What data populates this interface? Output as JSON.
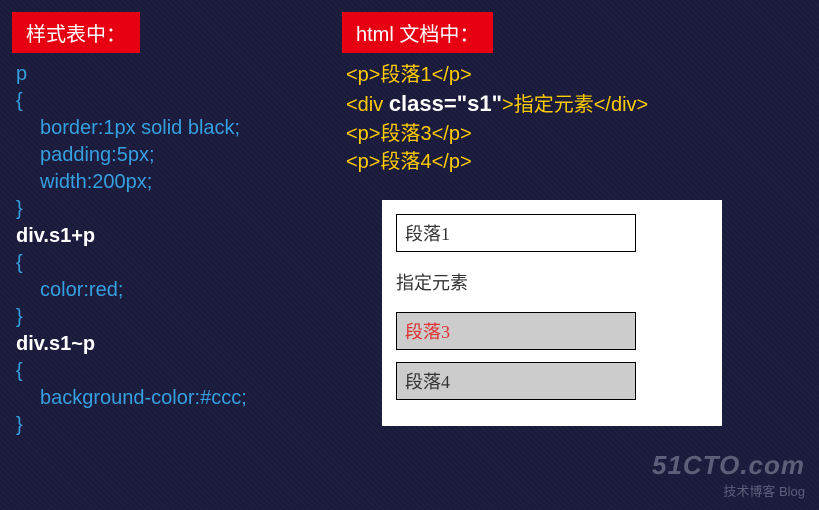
{
  "labels": {
    "css_header": "样式表中：",
    "html_header": "html 文档中："
  },
  "css": {
    "sel1": "p",
    "brace_open": "{",
    "brace_close": "}",
    "prop1": "border:1px solid black;",
    "prop2": "padding:5px;",
    "prop3": "width:200px;",
    "sel2": "div.s1+p",
    "prop4": "color:red;",
    "sel3": "div.s1~p",
    "prop5": "background-color:#ccc;"
  },
  "html_lines": {
    "l1_open": "<p>",
    "l1_text": "段落1",
    "l1_close": "</p>",
    "l2_open": "<div ",
    "l2_attr": "class=\"s1\"",
    "l2_mid": ">",
    "l2_text": "指定元素",
    "l2_close": "</div>",
    "l3_open": "<p>",
    "l3_text": "段落3",
    "l3_close": "</p>",
    "l4_open": "<p>",
    "l4_text": "段落4",
    "l4_close": "</p>"
  },
  "preview": {
    "p1": "段落1",
    "div1": "指定元素",
    "p3": "段落3",
    "p4": "段落4"
  },
  "watermark": {
    "domain": "51CTO.com",
    "sub": "技术博客",
    "blog": "Blog"
  }
}
